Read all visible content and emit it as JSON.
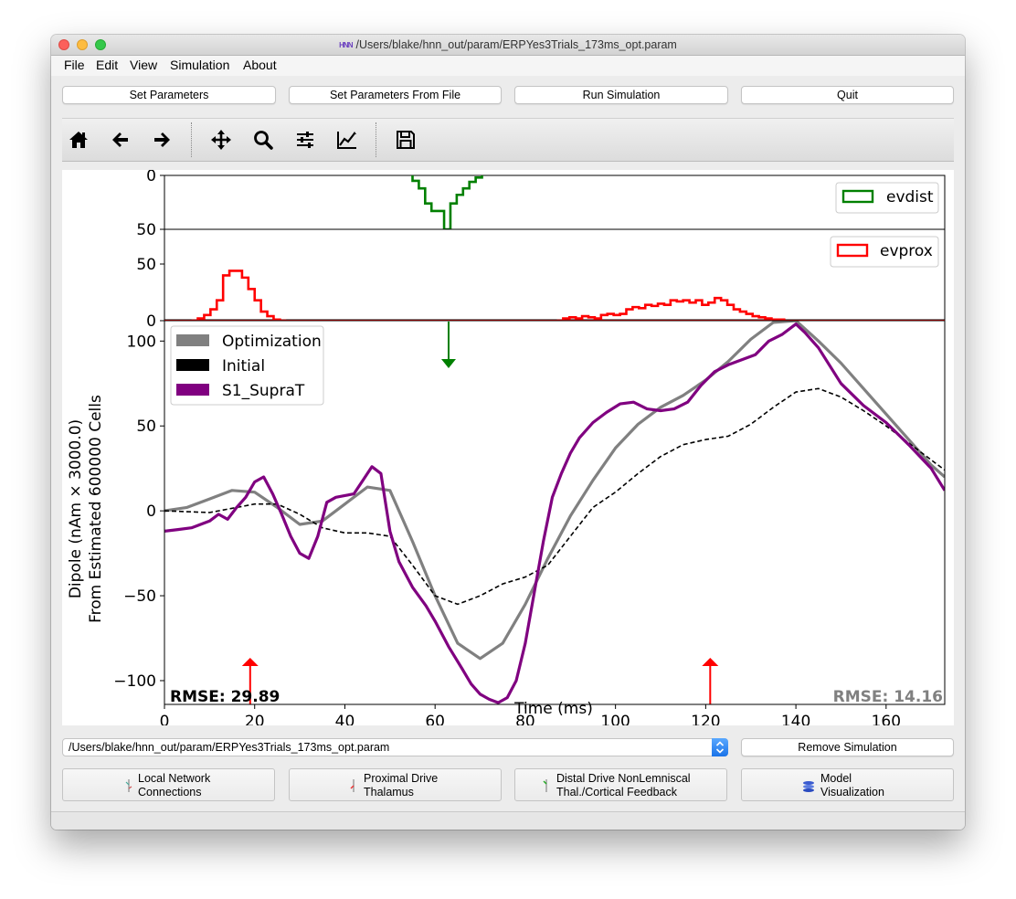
{
  "window": {
    "title": "/Users/blake/hnn_out/param/ERPYes3Trials_173ms_opt.param",
    "app_icon_text": "HNN"
  },
  "menu": [
    "File",
    "Edit",
    "View",
    "Simulation",
    "About"
  ],
  "buttons_top": {
    "set_parameters": "Set Parameters",
    "set_parameters_from_file": "Set Parameters From File",
    "run_simulation": "Run Simulation",
    "quit": "Quit"
  },
  "toolbar_icons": [
    "home-icon",
    "back-icon",
    "forward-icon",
    "pan-icon",
    "zoom-icon",
    "configure-subplots-icon",
    "edit-axis-icon",
    "save-icon"
  ],
  "param_file_select": {
    "value": "/Users/blake/hnn_out/param/ERPYes3Trials_173ms_opt.param"
  },
  "remove_simulation": "Remove Simulation",
  "buttons_bottom": [
    {
      "line1": "Local Network",
      "line2": "Connections"
    },
    {
      "line1": "Proximal Drive",
      "line2": "Thalamus"
    },
    {
      "line1": "Distal Drive NonLemniscal",
      "line2": "Thal./Cortical Feedback"
    },
    {
      "line1": "Model",
      "line2": "Visualization"
    }
  ],
  "chart_data": [
    {
      "type": "bar",
      "name": "evdist histogram",
      "inverted_y": true,
      "ylim": [
        0,
        50
      ],
      "y_ticks": [
        "0",
        "50"
      ],
      "x_start": 55,
      "bin_width": 1.4,
      "values": [
        5,
        12,
        26,
        33,
        33,
        50,
        26,
        18,
        12,
        6,
        2
      ],
      "legend": [
        "evdist"
      ],
      "color": "#008000"
    },
    {
      "type": "bar",
      "name": "evprox histogram",
      "ylim": [
        0,
        50
      ],
      "y_ticks": [
        "50",
        "0"
      ],
      "legend": [
        "evprox"
      ],
      "color": "#ff0000",
      "x_start": 6,
      "bin_width": 1.4,
      "values_group1": [
        0,
        2,
        5,
        10,
        18,
        40,
        44,
        44,
        38,
        28,
        18,
        8,
        4,
        1,
        0
      ],
      "values_group2_x_start": 87,
      "values_group2": [
        0,
        2,
        3,
        2,
        4,
        3,
        2,
        5,
        6,
        5,
        6,
        10,
        12,
        11,
        14,
        13,
        15,
        14,
        18,
        17,
        18,
        16,
        18,
        14,
        16,
        20,
        18,
        14,
        10,
        8,
        6,
        4,
        3,
        2,
        1,
        1
      ]
    },
    {
      "type": "line",
      "xlabel": "Time (ms)",
      "ylabel_line1": "Dipole (nAm × 3000.0)",
      "ylabel_line2": "From Estimated 600000 Cells",
      "xlim": [
        0,
        173
      ],
      "ylim": [
        -114,
        112
      ],
      "x_ticks": [
        0,
        20,
        40,
        60,
        80,
        100,
        120,
        140,
        160
      ],
      "x_tick_labels": [
        "0",
        "20",
        "40",
        "60",
        "80",
        "100",
        "120",
        "140",
        "160"
      ],
      "y_ticks": [
        100,
        50,
        0,
        -50,
        -100
      ],
      "y_tick_labels": [
        "100",
        "50",
        "0",
        "−50",
        "−100"
      ],
      "legend": [
        "Optimization",
        "Initial",
        "S1_SupraT"
      ],
      "rmse_left": "RMSE: 29.89",
      "rmse_right": "RMSE: 14.16",
      "markers": [
        {
          "type": "arrow-down",
          "x": 63.0,
          "color": "#008000"
        },
        {
          "type": "arrow-up",
          "x": 19.0,
          "color": "#ff0000"
        },
        {
          "type": "arrow-up",
          "x": 121.0,
          "color": "#ff0000"
        }
      ],
      "series": [
        {
          "name": "Optimization",
          "color": "#808080",
          "x": [
            0,
            5,
            10,
            15,
            20,
            25,
            30,
            35,
            40,
            45,
            50,
            55,
            60,
            65,
            70,
            75,
            80,
            85,
            90,
            95,
            100,
            105,
            110,
            115,
            120,
            125,
            130,
            135,
            140,
            145,
            150,
            155,
            160,
            165,
            170,
            173
          ],
          "y": [
            0,
            2,
            7,
            12,
            11,
            2,
            -8,
            -6,
            4,
            14,
            12,
            -18,
            -50,
            -78,
            -87,
            -78,
            -55,
            -28,
            -3,
            18,
            37,
            51,
            61,
            68,
            77,
            88,
            101,
            111,
            112,
            100,
            87,
            72,
            57,
            42,
            27,
            20
          ]
        },
        {
          "name": "Initial",
          "color": "#000000",
          "x": [
            0,
            10,
            20,
            25,
            30,
            35,
            40,
            45,
            50,
            55,
            60,
            65,
            70,
            75,
            80,
            85,
            90,
            95,
            100,
            105,
            110,
            115,
            120,
            125,
            130,
            135,
            140,
            145,
            150,
            155,
            160,
            165,
            170,
            173
          ],
          "y": [
            0,
            -1,
            4,
            4,
            -2,
            -10,
            -13,
            -13,
            -15,
            -32,
            -50,
            -55,
            -50,
            -43,
            -39,
            -32,
            -15,
            2,
            11,
            22,
            32,
            39,
            42,
            44,
            51,
            61,
            70,
            72,
            67,
            59,
            50,
            40,
            30,
            24
          ]
        },
        {
          "name": "S1_SupraT",
          "color": "#800080",
          "x": [
            0,
            3,
            6,
            7,
            8,
            10,
            12,
            14,
            16,
            18,
            20,
            22,
            24,
            26,
            28,
            30,
            32,
            34,
            36,
            38,
            40,
            42,
            44,
            46,
            48,
            50,
            52,
            55,
            58,
            60,
            63,
            66,
            68,
            70,
            72,
            74,
            76,
            78,
            80,
            82,
            84,
            86,
            88,
            90,
            92,
            95,
            98,
            101,
            104,
            107,
            110,
            113,
            116,
            119,
            122,
            125,
            128,
            131,
            134,
            137,
            140,
            142,
            145,
            150,
            155,
            160,
            165,
            170,
            173
          ],
          "y": [
            -12,
            -11,
            -10,
            -9,
            -8,
            -6,
            -2,
            -5,
            2,
            8,
            17,
            20,
            10,
            -2,
            -15,
            -25,
            -28,
            -15,
            5,
            8,
            9,
            10,
            18,
            26,
            22,
            -12,
            -30,
            -45,
            -56,
            -65,
            -80,
            -93,
            -102,
            -108,
            -111,
            -113,
            -110,
            -100,
            -78,
            -48,
            -18,
            8,
            22,
            34,
            43,
            52,
            58,
            63,
            64,
            60,
            59,
            60,
            64,
            74,
            82,
            86,
            89,
            92,
            100,
            104,
            110,
            105,
            96,
            75,
            62,
            52,
            39,
            25,
            12
          ]
        }
      ]
    }
  ]
}
